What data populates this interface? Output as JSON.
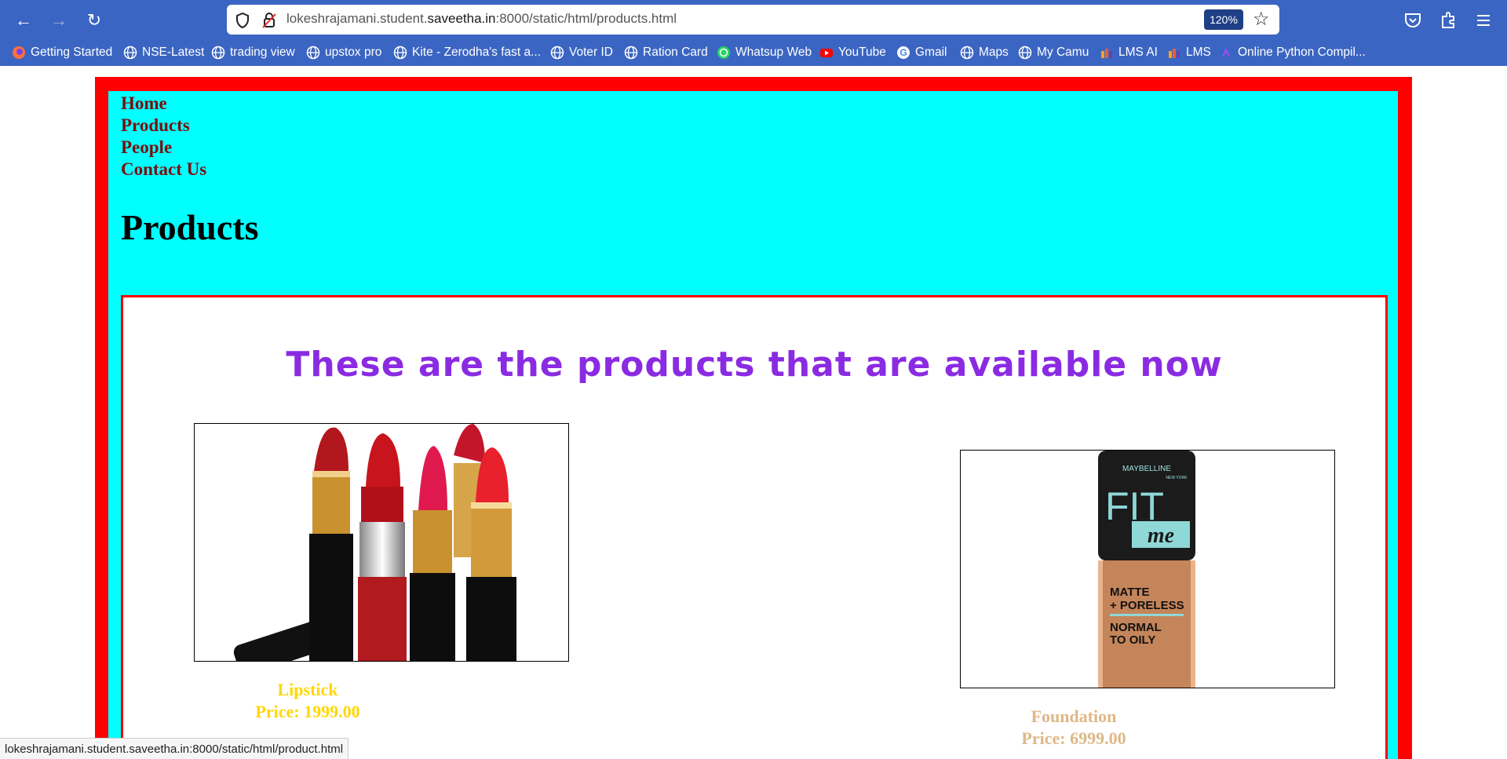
{
  "browser": {
    "url_host": "lokeshrajamani.student.",
    "url_domain": "saveetha.in",
    "url_path": ":8000/static/html/products.html",
    "zoom": "120%"
  },
  "bookmarks": [
    {
      "label": "Getting Started",
      "icon": "firefox-icon"
    },
    {
      "label": "NSE-Latest",
      "icon": "globe-icon"
    },
    {
      "label": "trading view",
      "icon": "globe-icon"
    },
    {
      "label": "upstox pro",
      "icon": "globe-icon"
    },
    {
      "label": "Kite - Zerodha's fast a...",
      "icon": "globe-icon"
    },
    {
      "label": "Voter ID",
      "icon": "globe-icon"
    },
    {
      "label": "Ration Card",
      "icon": "globe-icon"
    },
    {
      "label": "Whatsup Web",
      "icon": "whatsapp-icon"
    },
    {
      "label": "YouTube",
      "icon": "youtube-icon"
    },
    {
      "label": "Gmail",
      "icon": "google-icon"
    },
    {
      "label": "Maps",
      "icon": "globe-icon"
    },
    {
      "label": "My Camu",
      "icon": "globe-icon"
    },
    {
      "label": "LMS AI",
      "icon": "lms-icon"
    },
    {
      "label": "LMS",
      "icon": "lms-icon"
    },
    {
      "label": "Online Python Compil...",
      "icon": "python-icon"
    }
  ],
  "menu": [
    "Home",
    "Products",
    "People",
    "Contact Us"
  ],
  "page_title": "Products",
  "headline": "These are the products that are available now",
  "products": [
    {
      "name": "Lipstick",
      "price": "Price: 1999.00",
      "color": "#ffd700"
    },
    {
      "name": "Foundation",
      "price": "Price: 6999.00",
      "color": "#deb887"
    }
  ],
  "foundation_label": {
    "brand": "MAYBELLINE",
    "sub": "NEW YORK",
    "fit": "FIT",
    "me": "me",
    "line1": "MATTE",
    "line2": "+ PORELESS",
    "line3": "NORMAL",
    "line4": "TO OILY"
  },
  "status_url": "lokeshrajamani.student.saveetha.in:8000/static/html/product.html",
  "colors": {
    "outer_border": "#ff0000",
    "page_bg": "#00ffff",
    "menu_link": "#7a0f0f",
    "headline": "#8a2be2"
  }
}
